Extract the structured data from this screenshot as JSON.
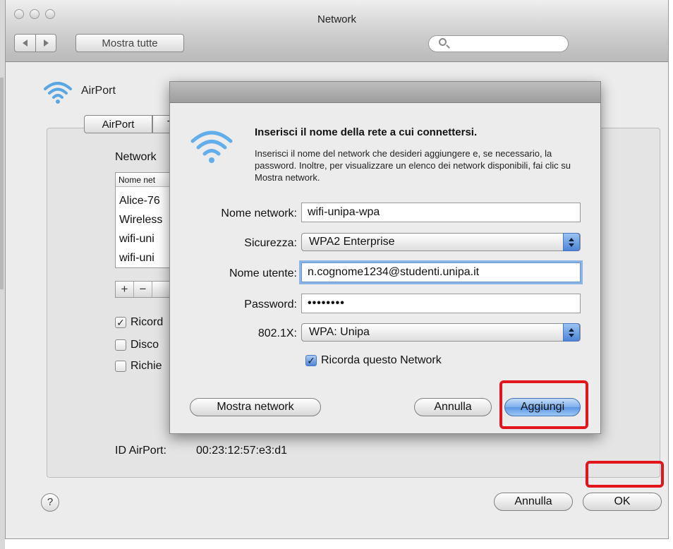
{
  "window": {
    "title": "Network",
    "toolbar": {
      "show_all_label": "Mostra tutte",
      "search_placeholder": ""
    }
  },
  "pane": {
    "service_label": "AirPort",
    "tabs": [
      "AirPort",
      "T"
    ],
    "network_label": "Network",
    "list_header": "Nome net",
    "list_items": [
      "Alice-76",
      "Wireless",
      "wifi-uni",
      "wifi-uni"
    ],
    "plus_label": "+",
    "minus_label": "−",
    "checkboxes": [
      {
        "label": "Ricord",
        "checked": true
      },
      {
        "label": "Disco",
        "checked": false
      },
      {
        "label": "Richie",
        "checked": false
      }
    ],
    "airport_id_label": "ID AirPort:",
    "airport_id_value": "00:23:12:57:e3:d1",
    "help_label": "?",
    "cancel_label": "Annulla",
    "ok_label": "OK"
  },
  "sheet": {
    "title": "Inserisci il nome della rete a cui connettersi.",
    "description": "Inserisci il nome del network che desideri aggiungere e, se necessario, la password. Inoltre, per visualizzare un elenco dei network disponibili, fai clic su Mostra network.",
    "fields": {
      "network_name_label": "Nome network:",
      "network_name_value": "wifi-unipa-wpa",
      "security_label": "Sicurezza:",
      "security_value": "WPA2 Enterprise",
      "username_label": "Nome utente:",
      "username_value": "n.cognome1234@studenti.unipa.it",
      "password_label": "Password:",
      "password_value": "••••••••",
      "dot1x_label": "802.1X:",
      "dot1x_value": "WPA: Unipa"
    },
    "remember_label": "Ricorda questo Network",
    "remember_checked": true,
    "show_networks_label": "Mostra network",
    "cancel_label": "Annulla",
    "add_label": "Aggiungi"
  },
  "colors": {
    "highlight_annotation": "#e2141c",
    "focus_ring": "#8bb4e7",
    "default_button": "#5c97e4"
  }
}
